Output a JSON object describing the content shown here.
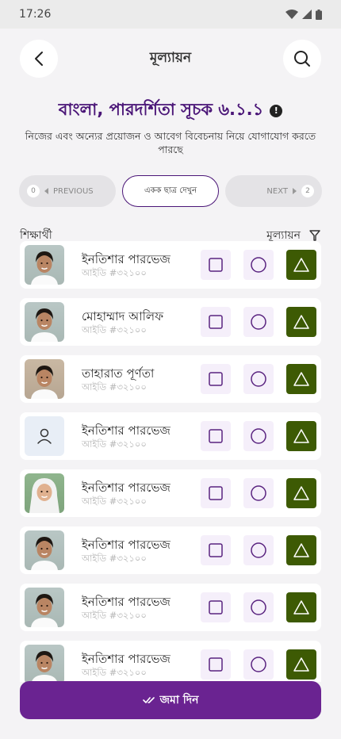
{
  "status_bar": {
    "time": "17:26"
  },
  "header": {
    "title": "মূল্যায়ন"
  },
  "subject": {
    "title": "বাংলা, পারদর্শিতা সূচক ৬.১.১",
    "description": "নিজের এবং অন্যের প্রয়োজন ও  আবেগ বিবেচনায় নিয়ে যোগাযোগ করতে পারছে"
  },
  "pager": {
    "prev_label": "PREVIOUS",
    "prev_count": "0",
    "center_label": "একক ছাত্র দেখুন",
    "next_label": "NEXT",
    "next_count": "2"
  },
  "columns": {
    "student": "শিক্ষার্থী",
    "evaluation": "মূল্যায়ন"
  },
  "students": [
    {
      "name": "ইনতিশার পারভেজ",
      "id": "আইডি #৩২১০০",
      "avatar": "photo-boy",
      "selected": "triangle"
    },
    {
      "name": "মোহাম্মাদ আলিফ",
      "id": "আইডি #৩২১০০",
      "avatar": "photo-boy",
      "selected": "triangle"
    },
    {
      "name": "তাহারাত পূর্ণতা",
      "id": "আইডি #৩২১০০",
      "avatar": "photo-girl",
      "selected": "triangle"
    },
    {
      "name": "ইনতিশার পারভেজ",
      "id": "আইডি #৩২১০০",
      "avatar": "placeholder",
      "selected": "triangle"
    },
    {
      "name": "ইনতিশার পারভেজ",
      "id": "আইডি #৩২১০০",
      "avatar": "photo-hijab",
      "selected": "triangle"
    },
    {
      "name": "ইনতিশার পারভেজ",
      "id": "আইডি #৩২১০০",
      "avatar": "photo-boy",
      "selected": "triangle"
    },
    {
      "name": "ইনতিশার পারভেজ",
      "id": "আইডি #৩২১০০",
      "avatar": "photo-boy",
      "selected": "triangle"
    },
    {
      "name": "ইনতিশার পারভেজ",
      "id": "আইডি #৩২১০০",
      "avatar": "photo-boy",
      "selected": "triangle"
    }
  ],
  "submit": {
    "label": "জমা দিন"
  },
  "colors": {
    "primary": "#6a2391",
    "title": "#4a1577",
    "active_eval": "#3d5a04",
    "eval_bg": "#f5effa"
  }
}
